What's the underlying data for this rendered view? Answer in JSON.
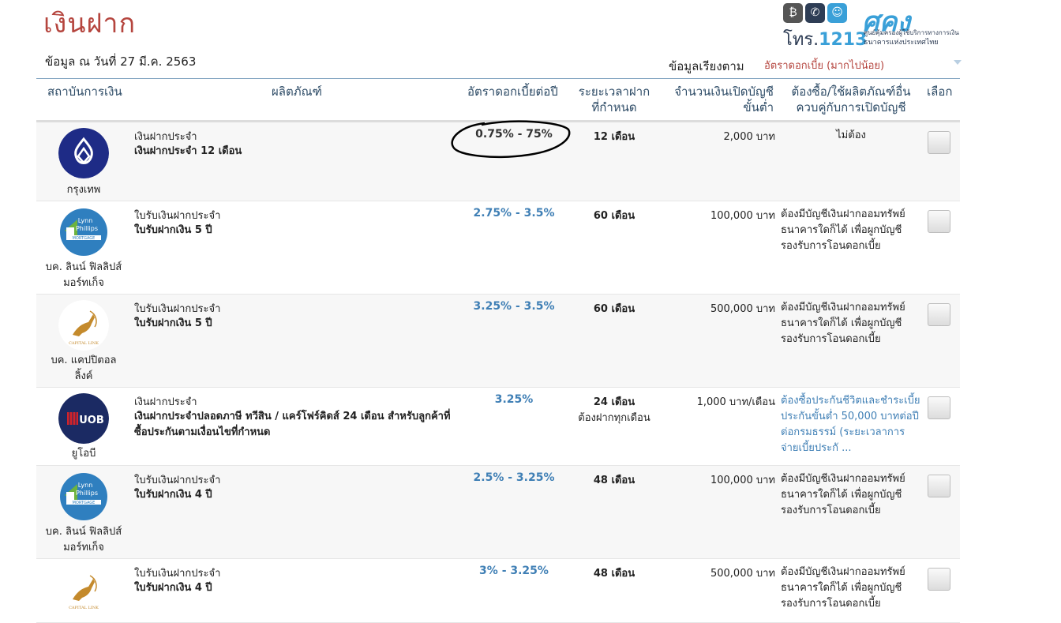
{
  "page": {
    "title": "เงินฝาก",
    "data_date": "ข้อมูล ณ วันที่ 27 มี.ค. 2563",
    "sort_label": "ข้อมูลเรียงตาม",
    "sort_value": "อัตราดอกเบี้ย (มากไปน้อย)"
  },
  "logo": {
    "tel_prefix": "โทร.",
    "tel_number": "1213",
    "brand": "ศคง",
    "subtitle_1": "ศูนย์คุ้มครองผู้ใช้บริการทางการเงิน",
    "subtitle_2": "ธนาคารแห่งประเทศไทย",
    "icons": [
      "bitcoin-icon",
      "phone-icon",
      "smile-icon"
    ]
  },
  "headers": {
    "institution": "สถาบันการเงิน",
    "product": "ผลิตภัณฑ์",
    "rate": "อัตราดอกเบี้ยต่อปี",
    "term_1": "ระยะเวลาฝาก",
    "term_2": "ที่กำหนด",
    "min_1": "จำนวนเงินเปิดบัญชี",
    "min_2": "ขั้นต่ำ",
    "req_1": "ต้องซื้อ/ใช้ผลิตภัณฑ์อื่น",
    "req_2": "ควบคู่กับการเปิดบัญชี",
    "select": "เลือก"
  },
  "rows": [
    {
      "bank_1": "กรุงเทพ",
      "bank_2": "",
      "type": "เงินฝากประจำ",
      "name": "เงินฝากประจำ 12 เดือน",
      "rate": "0.75% - 75%",
      "term": "12 เดือน",
      "term_sub": "",
      "min": "2,000 บาท",
      "req": "ไม่ต้อง"
    },
    {
      "bank_1": "บค. ลินน์ ฟิลลิปส์",
      "bank_2": "มอร์ทเก็จ",
      "type": "ใบรับเงินฝากประจำ",
      "name": "ใบรับฝากเงิน 5 ปี",
      "rate": "2.75% - 3.5%",
      "term": "60 เดือน",
      "term_sub": "",
      "min": "100,000 บาท",
      "req": "ต้องมีบัญชีเงินฝากออมทรัพย์ ธนาคารใดก็ได้ เพื่อผูกบัญชี รองรับการโอนดอกเบี้ย"
    },
    {
      "bank_1": "บค. แคปปิตอล",
      "bank_2": "ลิ้งค์",
      "type": "ใบรับเงินฝากประจำ",
      "name": "ใบรับฝากเงิน 5 ปี",
      "rate": "3.25% - 3.5%",
      "term": "60 เดือน",
      "term_sub": "",
      "min": "500,000 บาท",
      "req": "ต้องมีบัญชีเงินฝากออมทรัพย์ ธนาคารใดก็ได้ เพื่อผูกบัญชี รองรับการโอนดอกเบี้ย"
    },
    {
      "bank_1": "ยูโอบี",
      "bank_2": "",
      "type": "เงินฝากประจำ",
      "name": "เงินฝากประจำปลอดภาษี ทวีสิน / แคร์โฟร์คิดส์ 24 เดือน สำหรับลูกค้าที่ซื้อประกันตามเงื่อนไขที่กำหนด",
      "rate": "3.25%",
      "term": "24 เดือน",
      "term_sub": "ต้องฝากทุกเดือน",
      "min": "1,000 บาท/เดือน",
      "req": "ต้องซื้อประกันชีวิตและชำระเบี้ยประกันขั้นต่ำ 50,000 บาทต่อปี ต่อกรมธรรม์ (ระยะเวลาการจ่ายเบี้ยประกั ..."
    },
    {
      "bank_1": "บค. ลินน์ ฟิลลิปส์",
      "bank_2": "มอร์ทเก็จ",
      "type": "ใบรับเงินฝากประจำ",
      "name": "ใบรับฝากเงิน 4 ปี",
      "rate": "2.5% - 3.25%",
      "term": "48 เดือน",
      "term_sub": "",
      "min": "100,000 บาท",
      "req": "ต้องมีบัญชีเงินฝากออมทรัพย์ ธนาคารใดก็ได้ เพื่อผูกบัญชี รองรับการโอนดอกเบี้ย"
    },
    {
      "bank_1": "",
      "bank_2": "",
      "type": "ใบรับเงินฝากประจำ",
      "name": "ใบรับฝากเงิน 4 ปี",
      "rate": "3% - 3.25%",
      "term": "48 เดือน",
      "term_sub": "",
      "min": "500,000 บาท",
      "req": "ต้องมีบัญชีเงินฝากออมทรัพย์ ธนาคารใดก็ได้ เพื่อผูกบัญชี รองรับการโอนดอกเบี้ย"
    }
  ],
  "colors": {
    "title": "#b5453e",
    "rate_link": "#3f7fb5",
    "header_text": "#2d4b66"
  }
}
